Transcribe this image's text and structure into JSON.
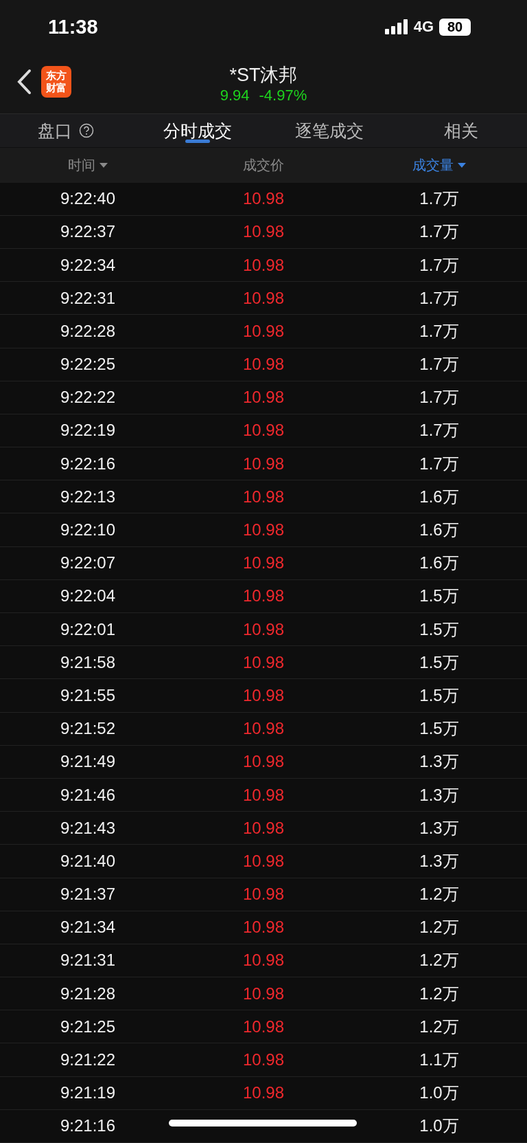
{
  "status_bar": {
    "time": "11:38",
    "network": "4G",
    "battery": "80"
  },
  "header": {
    "logo": [
      "东方",
      "财富"
    ],
    "title": "*ST沐邦",
    "quote": {
      "price": "9.94",
      "change": "-4.97%",
      "down": true
    }
  },
  "tabs": [
    {
      "label": "盘口",
      "help": true,
      "selected": false
    },
    {
      "label": "分时成交",
      "help": false,
      "selected": true
    },
    {
      "label": "逐笔成交",
      "help": false,
      "selected": false
    },
    {
      "label": "相关",
      "help": false,
      "selected": false
    }
  ],
  "table": {
    "columns": [
      {
        "label": "时间",
        "sortable": true,
        "selected": false
      },
      {
        "label": "成交价",
        "sortable": false,
        "selected": false
      },
      {
        "label": "成交量",
        "sortable": true,
        "selected": true
      }
    ],
    "rows": [
      {
        "time": "9:22:40",
        "price": "10.98",
        "up": true,
        "volume": "1.7万"
      },
      {
        "time": "9:22:37",
        "price": "10.98",
        "up": true,
        "volume": "1.7万"
      },
      {
        "time": "9:22:34",
        "price": "10.98",
        "up": true,
        "volume": "1.7万"
      },
      {
        "time": "9:22:31",
        "price": "10.98",
        "up": true,
        "volume": "1.7万"
      },
      {
        "time": "9:22:28",
        "price": "10.98",
        "up": true,
        "volume": "1.7万"
      },
      {
        "time": "9:22:25",
        "price": "10.98",
        "up": true,
        "volume": "1.7万"
      },
      {
        "time": "9:22:22",
        "price": "10.98",
        "up": true,
        "volume": "1.7万"
      },
      {
        "time": "9:22:19",
        "price": "10.98",
        "up": true,
        "volume": "1.7万"
      },
      {
        "time": "9:22:16",
        "price": "10.98",
        "up": true,
        "volume": "1.7万"
      },
      {
        "time": "9:22:13",
        "price": "10.98",
        "up": true,
        "volume": "1.6万"
      },
      {
        "time": "9:22:10",
        "price": "10.98",
        "up": true,
        "volume": "1.6万"
      },
      {
        "time": "9:22:07",
        "price": "10.98",
        "up": true,
        "volume": "1.6万"
      },
      {
        "time": "9:22:04",
        "price": "10.98",
        "up": true,
        "volume": "1.5万"
      },
      {
        "time": "9:22:01",
        "price": "10.98",
        "up": true,
        "volume": "1.5万"
      },
      {
        "time": "9:21:58",
        "price": "10.98",
        "up": true,
        "volume": "1.5万"
      },
      {
        "time": "9:21:55",
        "price": "10.98",
        "up": true,
        "volume": "1.5万"
      },
      {
        "time": "9:21:52",
        "price": "10.98",
        "up": true,
        "volume": "1.5万"
      },
      {
        "time": "9:21:49",
        "price": "10.98",
        "up": true,
        "volume": "1.3万"
      },
      {
        "time": "9:21:46",
        "price": "10.98",
        "up": true,
        "volume": "1.3万"
      },
      {
        "time": "9:21:43",
        "price": "10.98",
        "up": true,
        "volume": "1.3万"
      },
      {
        "time": "9:21:40",
        "price": "10.98",
        "up": true,
        "volume": "1.3万"
      },
      {
        "time": "9:21:37",
        "price": "10.98",
        "up": true,
        "volume": "1.2万"
      },
      {
        "time": "9:21:34",
        "price": "10.98",
        "up": true,
        "volume": "1.2万"
      },
      {
        "time": "9:21:31",
        "price": "10.98",
        "up": true,
        "volume": "1.2万"
      },
      {
        "time": "9:21:28",
        "price": "10.98",
        "up": true,
        "volume": "1.2万"
      },
      {
        "time": "9:21:25",
        "price": "10.98",
        "up": true,
        "volume": "1.2万"
      },
      {
        "time": "9:21:22",
        "price": "10.98",
        "up": true,
        "volume": "1.1万"
      },
      {
        "time": "9:21:19",
        "price": "10.98",
        "up": true,
        "volume": "1.0万"
      },
      {
        "time": "9:21:16",
        "volume": "1.0万"
      }
    ]
  }
}
